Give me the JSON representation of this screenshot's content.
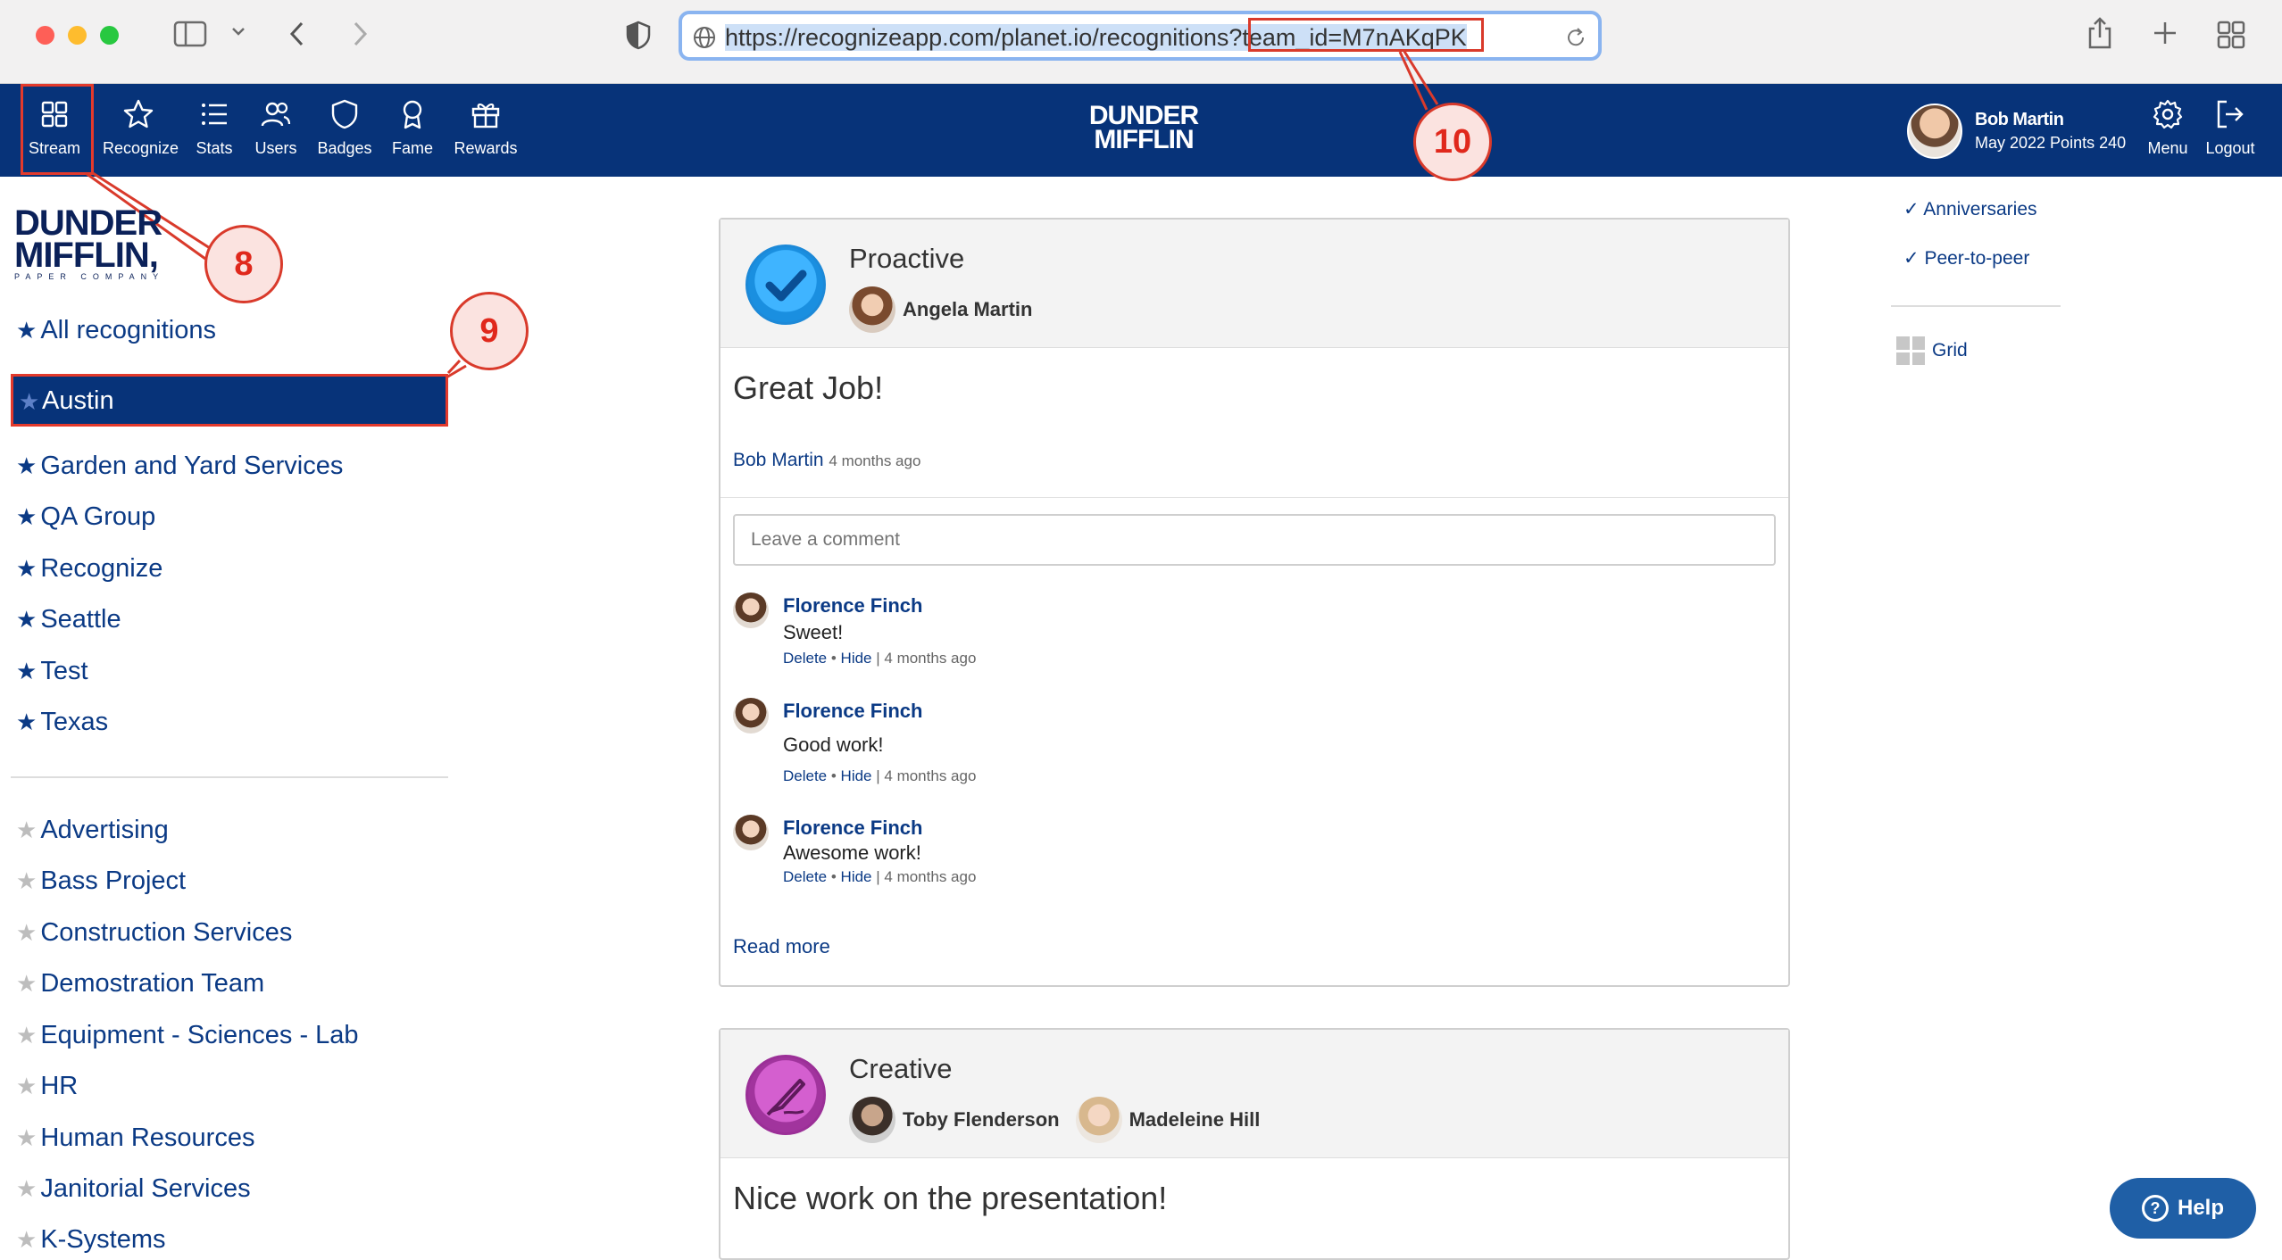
{
  "browser": {
    "url_base": "https://recognizeapp.com/planet.io/recognitions?",
    "url_query": "team_id=M7nAKqPK"
  },
  "nav": {
    "items": [
      {
        "label": "Stream",
        "icon": "grid-icon"
      },
      {
        "label": "Recognize",
        "icon": "star-icon"
      },
      {
        "label": "Stats",
        "icon": "list-icon"
      },
      {
        "label": "Users",
        "icon": "users-icon"
      },
      {
        "label": "Badges",
        "icon": "shield-icon"
      },
      {
        "label": "Fame",
        "icon": "ribbon-icon"
      },
      {
        "label": "Rewards",
        "icon": "gift-icon"
      }
    ],
    "brand_line1": "DUNDER",
    "brand_line2": "MIFFLIN",
    "user_name": "Bob Martin",
    "user_points": "May 2022 Points 240",
    "menu_label": "Menu",
    "logout_label": "Logout",
    "accent_color": "#073379"
  },
  "callouts": [
    "8",
    "9",
    "10"
  ],
  "sidebar": {
    "logo_line1": "DUNDER",
    "logo_line2": "MIFFLIN,",
    "logo_sub": "PAPER COMPANY",
    "fav_teams": [
      "All recognitions",
      "Austin",
      "Garden and Yard Services",
      "QA Group",
      "Recognize",
      "Seattle",
      "Test",
      "Texas"
    ],
    "active_team": "Austin",
    "other_teams": [
      "Advertising",
      "Bass Project",
      "Construction Services",
      "Demostration Team",
      "Equipment - Sciences - Lab",
      "HR",
      "Human Resources",
      "Janitorial Services",
      "K-Systems"
    ]
  },
  "cards": [
    {
      "badge": "Proactive",
      "recipients": [
        "Angela Martin"
      ],
      "message": "Great Job!",
      "sender": "Bob Martin",
      "sender_ago": "4 months ago",
      "comment_placeholder": "Leave a comment",
      "comments": [
        {
          "name": "Florence Finch",
          "text": "Sweet!",
          "delete": "Delete",
          "hide": "Hide",
          "ago": "4 months ago"
        },
        {
          "name": "Florence Finch",
          "text": "Good work!",
          "delete": "Delete",
          "hide": "Hide",
          "ago": "4 months ago"
        },
        {
          "name": "Florence Finch",
          "text": "Awesome work!",
          "delete": "Delete",
          "hide": "Hide",
          "ago": "4 months ago"
        }
      ],
      "read_more": "Read more"
    },
    {
      "badge": "Creative",
      "recipients": [
        "Toby Flenderson",
        "Madeleine Hill"
      ],
      "message": "Nice work on the presentation!"
    }
  ],
  "right": {
    "filters": [
      "Anniversaries",
      "Peer-to-peer"
    ],
    "grid_label": "Grid"
  },
  "help_label": "Help"
}
